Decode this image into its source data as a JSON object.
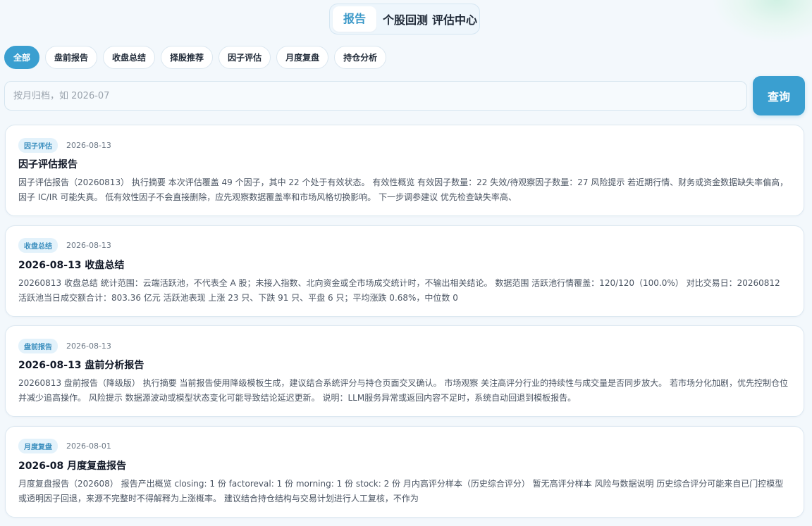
{
  "topnav": {
    "items": [
      {
        "label": "报告",
        "active": true
      },
      {
        "label": "个股回测",
        "active": false
      },
      {
        "label": "评估中心",
        "active": false
      }
    ]
  },
  "filters": [
    {
      "label": "全部",
      "active": true
    },
    {
      "label": "盘前报告",
      "active": false
    },
    {
      "label": "收盘总结",
      "active": false
    },
    {
      "label": "择股推荐",
      "active": false
    },
    {
      "label": "因子评估",
      "active": false
    },
    {
      "label": "月度复盘",
      "active": false
    },
    {
      "label": "持仓分析",
      "active": false
    }
  ],
  "search": {
    "placeholder": "按月归档，如 2026-07",
    "value": "",
    "button_label": "查询"
  },
  "reports": [
    {
      "tag": "因子评估",
      "date": "2026-08-13",
      "title": "因子评估报告",
      "summary": "因子评估报告（20260813） 执行摘要 本次评估覆盖 49 个因子，其中 22 个处于有效状态。 有效性概览 有效因子数量：22 失效/待观察因子数量：27 风险提示 若近期行情、财务或资金数据缺失率偏高，因子 IC/IR 可能失真。 低有效性因子不会直接删除，应先观察数据覆盖率和市场风格切换影响。 下一步调参建议 优先检查缺失率高、"
    },
    {
      "tag": "收盘总结",
      "date": "2026-08-13",
      "title": "2026-08-13 收盘总结",
      "summary": "20260813 收盘总结 统计范围：云端活跃池，不代表全 A 股；未接入指数、北向资金或全市场成交统计时，不输出相关结论。 数据范围 活跃池行情覆盖：120/120（100.0%） 对比交易日：20260812 活跃池当日成交额合计：803.36 亿元 活跃池表现 上涨 23 只、下跌 91 只、平盘 6 只；平均涨跌 0.68%，中位数 0"
    },
    {
      "tag": "盘前报告",
      "date": "2026-08-13",
      "title": "2026-08-13 盘前分析报告",
      "summary": "20260813 盘前报告（降级版） 执行摘要 当前报告使用降级模板生成，建议结合系统评分与持仓页面交叉确认。 市场观察 关注高评分行业的持续性与成交量是否同步放大。 若市场分化加剧，优先控制仓位并减少追高操作。 风险提示 数据源波动或模型状态变化可能导致结论延迟更新。 说明：LLM服务异常或返回内容不足时，系统自动回退到模板报告。"
    },
    {
      "tag": "月度复盘",
      "date": "2026-08-01",
      "title": "2026-08 月度复盘报告",
      "summary": "月度复盘报告（202608） 报告产出概览 closing: 1 份 factoreval: 1 份 morning: 1 份 stock: 2 份 月内高评分样本（历史综合评分） 暂无高评分样本 风险与数据说明 历史综合评分可能来自已门控模型或透明因子回退，来源不完整时不得解释为上涨概率。 建议结合持仓结构与交易计划进行人工复核，不作为"
    }
  ]
}
